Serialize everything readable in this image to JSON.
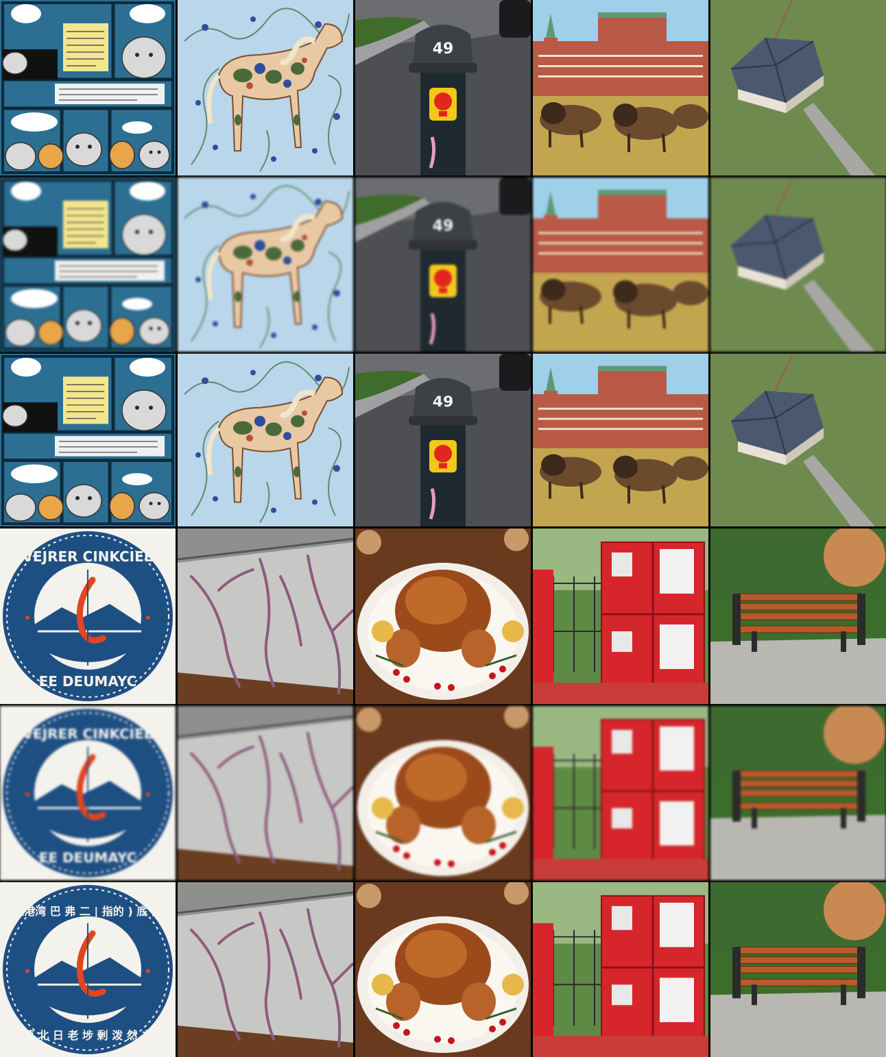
{
  "grid": {
    "rows": 6,
    "cols": 5
  },
  "texts": {
    "pole_number": "49",
    "seal_top_latin": "VEJRER CINKCIEE",
    "seal_bottom_latin": "EE DEUMAYC",
    "seal_top_cjk": "人港湾 巴 弗 二 | 指的 ) 底 匝",
    "seal_bottom_cjk": "藕 北 日 老 埗 剰 泼 然 书"
  },
  "colors": {
    "comic_blue": "#2c6f93",
    "horse_bg": "#b9d6ea",
    "kremlin_red": "#b85a45",
    "seal_blue": "#1e4f83",
    "cabinet_red": "#d6262b",
    "bench_wood": "#b85a2c"
  },
  "cells": [
    {
      "row": 0,
      "col": 0,
      "icon": "cat-comic"
    },
    {
      "row": 0,
      "col": 1,
      "icon": "floral-horse"
    },
    {
      "row": 0,
      "col": 2,
      "icon": "street-bollard"
    },
    {
      "row": 0,
      "col": 3,
      "icon": "bison-kremlin"
    },
    {
      "row": 0,
      "col": 4,
      "icon": "aerial-house"
    },
    {
      "row": 1,
      "col": 0,
      "icon": "cat-comic"
    },
    {
      "row": 1,
      "col": 1,
      "icon": "floral-horse"
    },
    {
      "row": 1,
      "col": 2,
      "icon": "street-bollard"
    },
    {
      "row": 1,
      "col": 3,
      "icon": "bison-kremlin"
    },
    {
      "row": 1,
      "col": 4,
      "icon": "aerial-house"
    },
    {
      "row": 2,
      "col": 0,
      "icon": "cat-comic"
    },
    {
      "row": 2,
      "col": 1,
      "icon": "floral-horse"
    },
    {
      "row": 2,
      "col": 2,
      "icon": "street-bollard"
    },
    {
      "row": 2,
      "col": 3,
      "icon": "bison-kremlin"
    },
    {
      "row": 2,
      "col": 4,
      "icon": "aerial-house"
    },
    {
      "row": 3,
      "col": 0,
      "icon": "round-seal"
    },
    {
      "row": 3,
      "col": 1,
      "icon": "cracked-wall"
    },
    {
      "row": 3,
      "col": 2,
      "icon": "roast-turkey"
    },
    {
      "row": 3,
      "col": 3,
      "icon": "red-cabinet"
    },
    {
      "row": 3,
      "col": 4,
      "icon": "park-bench"
    },
    {
      "row": 4,
      "col": 0,
      "icon": "round-seal"
    },
    {
      "row": 4,
      "col": 1,
      "icon": "cracked-wall"
    },
    {
      "row": 4,
      "col": 2,
      "icon": "roast-turkey"
    },
    {
      "row": 4,
      "col": 3,
      "icon": "red-cabinet"
    },
    {
      "row": 4,
      "col": 4,
      "icon": "park-bench"
    },
    {
      "row": 5,
      "col": 0,
      "icon": "round-seal"
    },
    {
      "row": 5,
      "col": 1,
      "icon": "cracked-wall"
    },
    {
      "row": 5,
      "col": 2,
      "icon": "roast-turkey"
    },
    {
      "row": 5,
      "col": 3,
      "icon": "red-cabinet"
    },
    {
      "row": 5,
      "col": 4,
      "icon": "park-bench"
    }
  ]
}
